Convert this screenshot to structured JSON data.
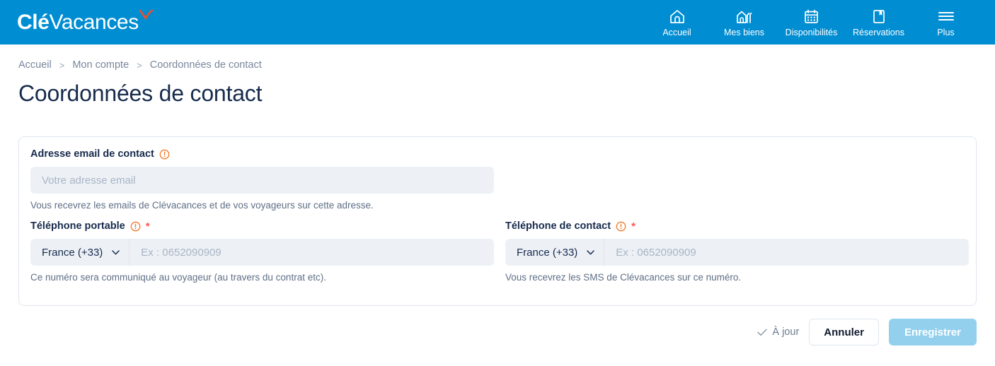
{
  "brand": {
    "logo_primary": "Clé",
    "logo_secondary": "Vacances",
    "header_color": "#008dd2",
    "accent_color": "#e8502e"
  },
  "nav": {
    "items": [
      {
        "label": "Accueil",
        "icon": "home-icon"
      },
      {
        "label": "Mes biens",
        "icon": "buildings-icon"
      },
      {
        "label": "Disponibilités",
        "icon": "calendar-icon"
      },
      {
        "label": "Réservations",
        "icon": "bookmark-icon"
      },
      {
        "label": "Plus",
        "icon": "hamburger-icon"
      }
    ]
  },
  "breadcrumb": {
    "items": [
      {
        "label": "Accueil"
      },
      {
        "label": "Mon compte"
      },
      {
        "label": "Coordonnées de contact"
      }
    ],
    "separator": ">"
  },
  "page": {
    "title": "Coordonnées de contact"
  },
  "form": {
    "email": {
      "label": "Adresse email de contact",
      "placeholder": "Votre adresse email",
      "value": "",
      "helper": "Vous recevrez les emails de Clévacances et de vos voyageurs sur cette adresse.",
      "info_icon": "info-icon",
      "required": false
    },
    "mobile_phone": {
      "label": "Téléphone portable",
      "required_marker": "*",
      "country": "France (+33)",
      "placeholder": "Ex : 0652090909",
      "value": "",
      "helper": "Ce numéro sera communiqué au voyageur (au travers du contrat etc).",
      "info_icon": "info-icon"
    },
    "contact_phone": {
      "label": "Téléphone de contact",
      "required_marker": "*",
      "country": "France (+33)",
      "placeholder": "Ex : 0652090909",
      "value": "",
      "helper": "Vous recevrez les SMS de Clévacances sur ce numéro.",
      "info_icon": "info-icon"
    }
  },
  "actions": {
    "status_label": "À jour",
    "status_icon": "check-icon",
    "cancel_label": "Annuler",
    "save_label": "Enregistrer",
    "save_disabled": true,
    "save_color": "#93d0ee"
  }
}
